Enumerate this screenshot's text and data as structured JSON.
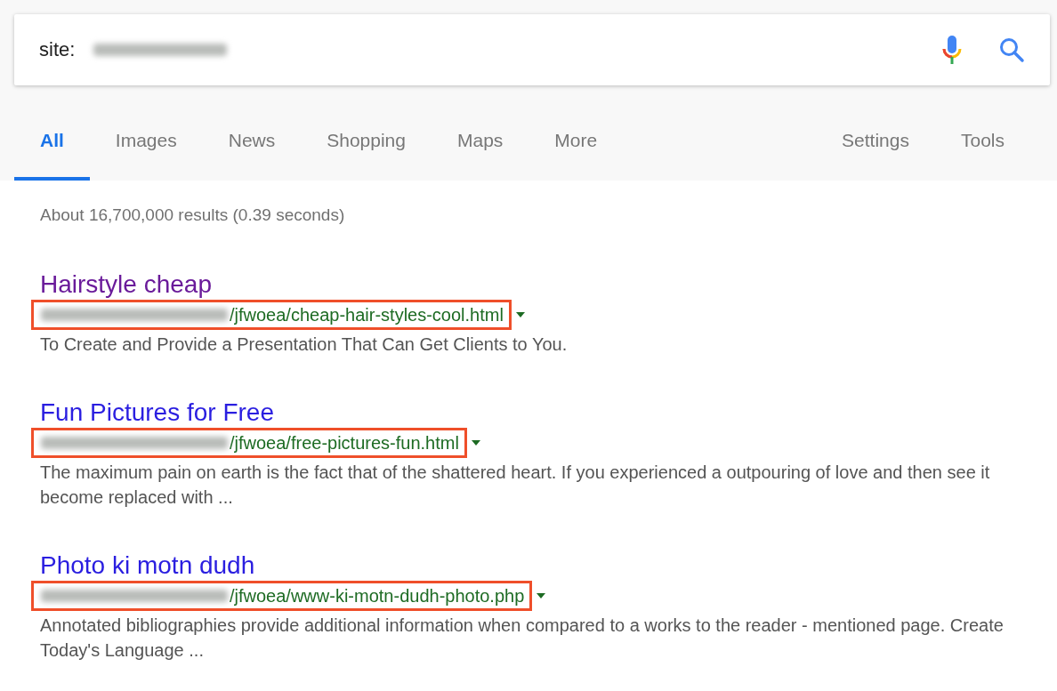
{
  "search": {
    "value": "site:",
    "value_blurred": true
  },
  "tabs": [
    {
      "label": "All",
      "selected": true
    },
    {
      "label": "Images",
      "selected": false
    },
    {
      "label": "News",
      "selected": false
    },
    {
      "label": "Shopping",
      "selected": false
    },
    {
      "label": "Maps",
      "selected": false
    },
    {
      "label": "More",
      "selected": false
    }
  ],
  "tools": [
    "Settings",
    "Tools"
  ],
  "result_stats": "About 16,700,000 results (0.39 seconds)",
  "results": [
    {
      "title": "Hairstyle cheap",
      "visited": true,
      "url": "/jfwoea/cheap-hair-styles-cool.html",
      "highlighted": true,
      "snippet": "To Create and Provide a Presentation That Can Get Clients to You."
    },
    {
      "title": "Fun Pictures for Free",
      "visited": false,
      "url": "/jfwoea/free-pictures-fun.html",
      "highlighted": true,
      "snippet": "The maximum pain on earth is the fact that of the shattered heart. If you experienced a outpouring of love and then see it become replaced with ..."
    },
    {
      "title": "Photo ki motn dudh",
      "visited": false,
      "url": "/jfwoea/www-ki-motn-dudh-photo.php",
      "highlighted": true,
      "snippet": "Annotated bibliographies provide additional information when compared to a works to the reader - mentioned page. Create Today's Language ..."
    }
  ]
}
